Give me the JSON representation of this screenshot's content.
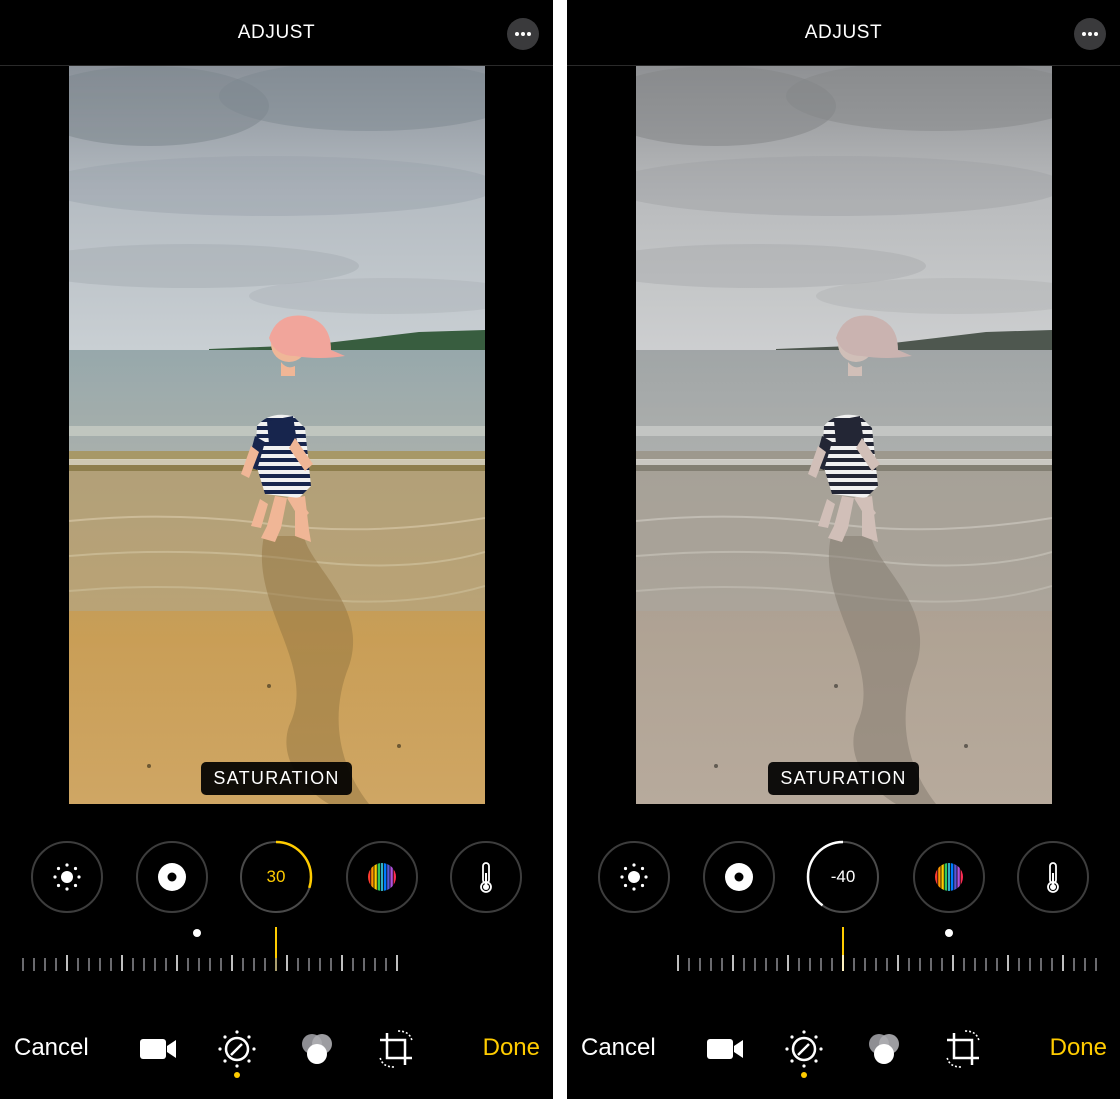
{
  "panels": [
    {
      "header": {
        "title": "ADJUST"
      },
      "photo": {
        "filter": "saturated"
      },
      "tool_label": "SATURATION",
      "dial": {
        "value": "30",
        "accent": "#ffcc00",
        "level": 0.3
      },
      "buttons": {
        "cancel": "Cancel",
        "done": "Done"
      },
      "icons": [
        "sun-icon",
        "contrast-icon",
        "spectrum-icon",
        "thermometer-icon",
        "video-icon",
        "adjust-dial-icon",
        "filters-icon",
        "crop-rotate-icon"
      ]
    },
    {
      "header": {
        "title": "ADJUST"
      },
      "photo": {
        "filter": "desaturated"
      },
      "tool_label": "SATURATION",
      "dial": {
        "value": "-40",
        "accent": "#ffffff",
        "level": -0.4
      },
      "buttons": {
        "cancel": "Cancel",
        "done": "Done"
      },
      "icons": [
        "sun-icon",
        "contrast-icon",
        "spectrum-icon",
        "thermometer-icon",
        "video-icon",
        "adjust-dial-icon",
        "filters-icon",
        "crop-rotate-icon"
      ]
    }
  ],
  "colors": {
    "accent": "#ffcc00",
    "background": "#000000",
    "ring": "#3d3d3d"
  }
}
